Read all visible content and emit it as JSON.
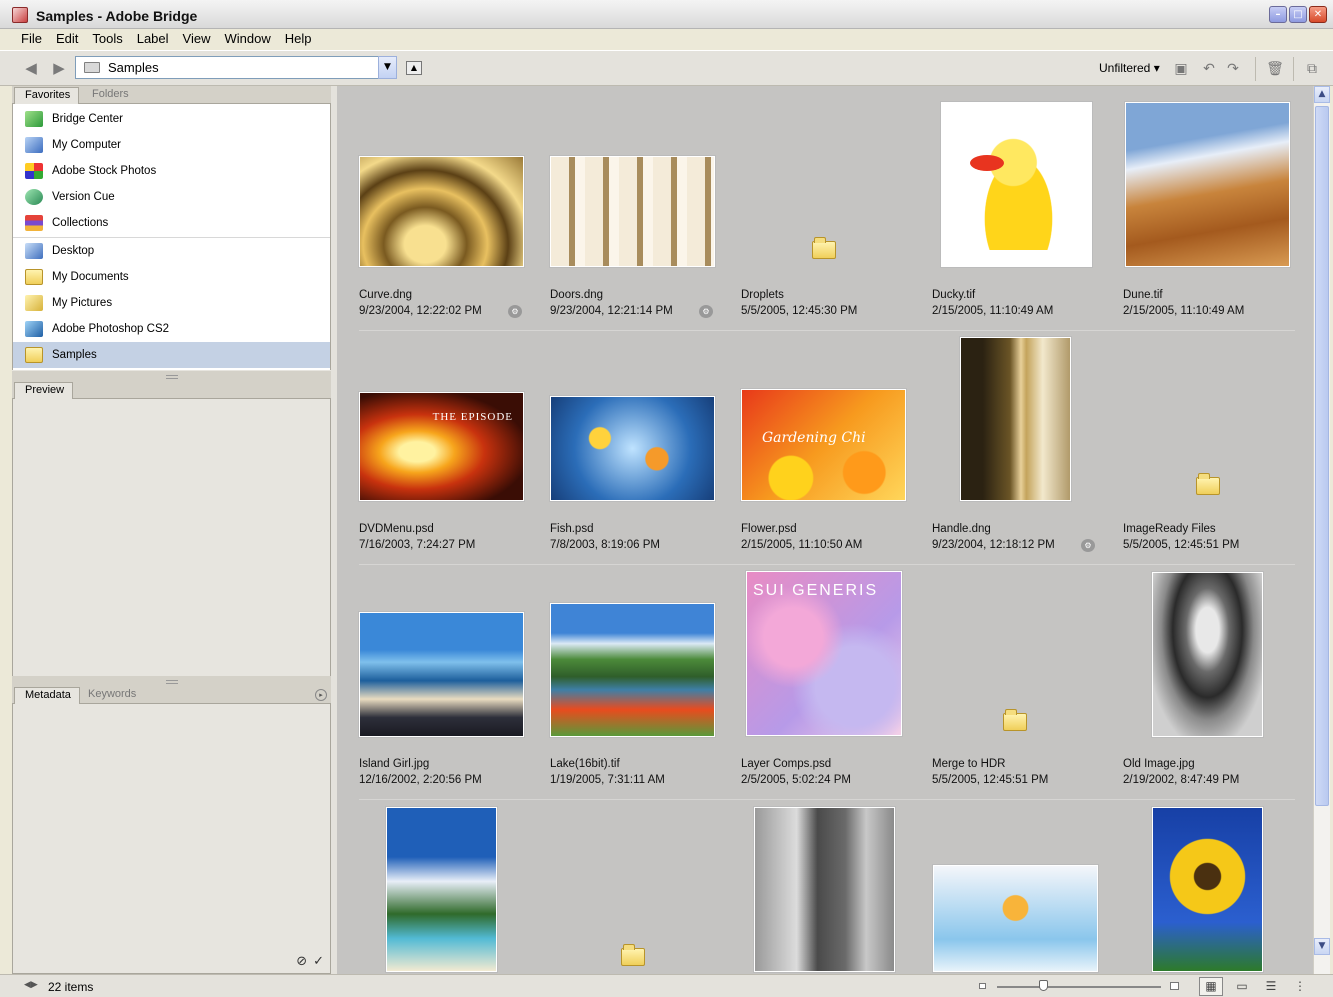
{
  "window": {
    "title": "Samples - Adobe Bridge",
    "controls": [
      "minimize",
      "maximize",
      "close"
    ]
  },
  "menu": [
    "File",
    "Edit",
    "Tools",
    "Label",
    "View",
    "Window",
    "Help"
  ],
  "toolbar": {
    "path": "Samples",
    "filter": "Unfiltered",
    "icons": [
      "back-icon",
      "forward-icon",
      "folder-icon",
      "dropdown-icon",
      "up-folder-icon",
      "new-folder-icon",
      "rotate-left-icon",
      "rotate-right-icon",
      "trash-icon",
      "compact-mode-icon"
    ]
  },
  "left_panel": {
    "top_tabs": [
      "Favorites",
      "Folders"
    ],
    "favorites": [
      {
        "label": "Bridge Center",
        "icon": "bridge-center-icon"
      },
      {
        "label": "My Computer",
        "icon": "computer-icon"
      },
      {
        "label": "Adobe Stock Photos",
        "icon": "stock-photos-icon"
      },
      {
        "label": "Version Cue",
        "icon": "version-cue-icon"
      },
      {
        "label": "Collections",
        "icon": "collections-icon"
      },
      {
        "label": "Desktop",
        "icon": "desktop-icon"
      },
      {
        "label": "My Documents",
        "icon": "folder-icon"
      },
      {
        "label": "My Pictures",
        "icon": "pictures-icon"
      },
      {
        "label": "Adobe Photoshop CS2",
        "icon": "photoshop-icon"
      },
      {
        "label": "Samples",
        "icon": "folder-icon",
        "selected": true
      }
    ],
    "preview_tab": "Preview",
    "bottom_tabs": [
      "Metadata",
      "Keywords"
    ]
  },
  "content": {
    "items": [
      {
        "name": "Curve.dng",
        "date": "9/23/2004, 12:22:02 PM",
        "type": "image",
        "badge": true
      },
      {
        "name": "Doors.dng",
        "date": "9/23/2004, 12:21:14 PM",
        "type": "image",
        "badge": true
      },
      {
        "name": "Droplets",
        "date": "5/5/2005, 12:45:30 PM",
        "type": "folder"
      },
      {
        "name": "Ducky.tif",
        "date": "2/15/2005, 11:10:49 AM",
        "type": "image"
      },
      {
        "name": "Dune.tif",
        "date": "2/15/2005, 11:10:49 AM",
        "type": "image"
      },
      {
        "name": "DVDMenu.psd",
        "date": "7/16/2003, 7:24:27 PM",
        "type": "image",
        "thumb_text": "THE EPISODE"
      },
      {
        "name": "Fish.psd",
        "date": "7/8/2003, 8:19:06 PM",
        "type": "image"
      },
      {
        "name": "Flower.psd",
        "date": "2/15/2005, 11:10:50 AM",
        "type": "image",
        "thumb_text": "Gardening Chi"
      },
      {
        "name": "Handle.dng",
        "date": "9/23/2004, 12:18:12 PM",
        "type": "image",
        "badge": true
      },
      {
        "name": "ImageReady Files",
        "date": "5/5/2005, 12:45:51 PM",
        "type": "folder"
      },
      {
        "name": "Island Girl.jpg",
        "date": "12/16/2002, 2:20:56 PM",
        "type": "image"
      },
      {
        "name": "Lake(16bit).tif",
        "date": "1/19/2005, 7:31:11 AM",
        "type": "image"
      },
      {
        "name": "Layer Comps.psd",
        "date": "2/5/2005, 5:02:24 PM",
        "type": "image",
        "thumb_text": "SUI GENERIS"
      },
      {
        "name": "Merge to HDR",
        "date": "5/5/2005, 12:45:51 PM",
        "type": "folder"
      },
      {
        "name": "Old Image.jpg",
        "date": "2/19/2002, 8:47:49 PM",
        "type": "image"
      },
      {
        "name": "",
        "date": "",
        "type": "image"
      },
      {
        "name": "",
        "date": "",
        "type": "folder"
      },
      {
        "name": "",
        "date": "",
        "type": "image"
      },
      {
        "name": "",
        "date": "",
        "type": "image"
      },
      {
        "name": "",
        "date": "",
        "type": "image"
      }
    ]
  },
  "status": {
    "count": "22 items"
  }
}
